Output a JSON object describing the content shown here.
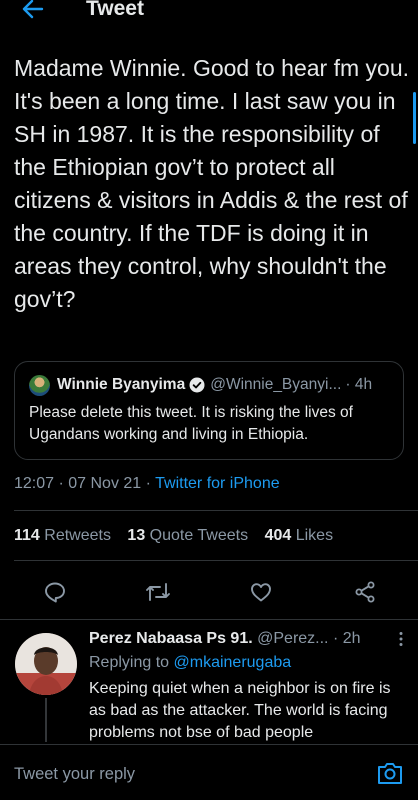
{
  "header": {
    "title": "Tweet"
  },
  "tweet": {
    "text": "Madame Winnie. Good to hear fm you. It's been a long time. I last saw you in SH in 1987. It is the responsibility of the Ethiopian gov’t to protect all citizens & visitors in Addis & the rest of the country. If the TDF is doing it in areas they control, why shouldn't the gov’t?",
    "time": "12:07 · 07 Nov 21 · ",
    "source": "Twitter for iPhone"
  },
  "quote": {
    "name": "Winnie Byanyima",
    "handle": "@Winnie_Byanyi...",
    "time": "· 4h",
    "text": "Please delete this tweet. It is risking the lives of Ugandans working and living in Ethiopia."
  },
  "stats": {
    "retweets_count": "114",
    "retweets_label": "Retweets",
    "quotes_count": "13",
    "quotes_label": "Quote Tweets",
    "likes_count": "404",
    "likes_label": "Likes"
  },
  "actions": [
    "reply-icon",
    "retweet-icon",
    "like-icon",
    "share-icon"
  ],
  "reply": {
    "name": "Perez Nabaasa Ps 91.",
    "handle": "@Perez...",
    "time": "· 2h",
    "replying_prefix": "Replying to ",
    "replying_handle": "@mkainerugaba",
    "text": "Keeping quiet when a neighbor is on fire is as bad as the attacker. The world is facing problems not bse of bad people"
  },
  "composer": {
    "placeholder": "Tweet your reply"
  },
  "colors": {
    "background": "#000000",
    "text": "#e7e9ea",
    "muted": "#8b98a5",
    "accent": "#1d9bf0",
    "border": "#2f3336"
  }
}
